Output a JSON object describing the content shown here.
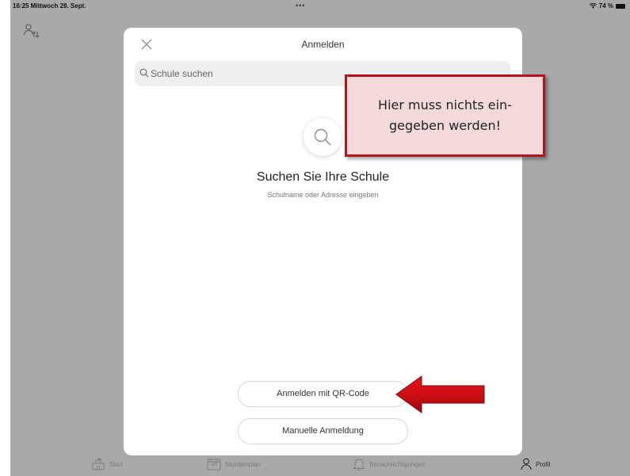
{
  "statusbar": {
    "time_date": "16:25  Mittwoch 28. Sept.",
    "dots": "•••",
    "battery_text": "74 %"
  },
  "dialog": {
    "title": "Anmelden",
    "search_placeholder": "Schule suchen",
    "empty_title": "Suchen Sie Ihre Schule",
    "empty_subtitle": "Schulname oder Adresse eingeben",
    "button_qr": "Anmelden mit QR-Code",
    "button_manual": "Manuelle Anmeldung"
  },
  "tabbar": {
    "items": [
      {
        "label": "Start",
        "icon": "home-icon"
      },
      {
        "label": "Stundenplan",
        "icon": "calendar-icon"
      },
      {
        "label": "Benachrichtigungen",
        "icon": "bell-icon"
      },
      {
        "label": "Profil",
        "icon": "person-icon"
      }
    ],
    "calendar_day": "28"
  },
  "annotation": {
    "callout_text": "Hier muss nichts ein-\ngegeben werden!",
    "color": "#b2151c"
  }
}
